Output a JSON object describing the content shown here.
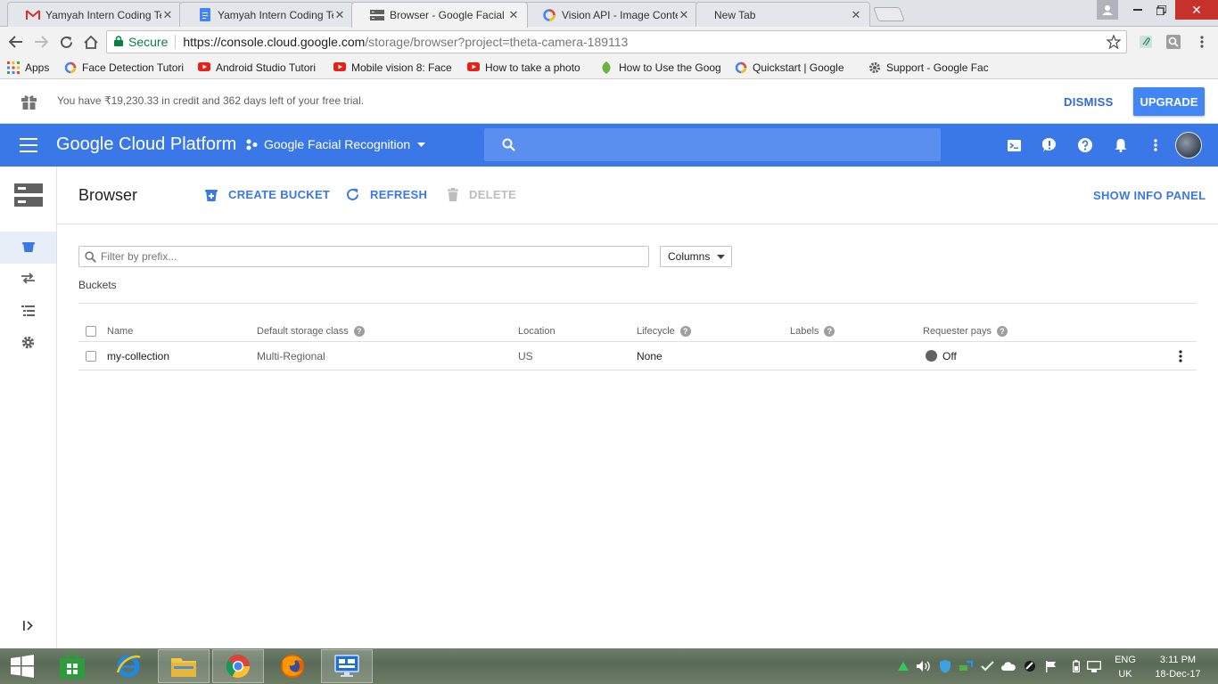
{
  "browser": {
    "tabs": [
      {
        "title": "Yamyah Intern Coding Te",
        "icon": "gmail-icon",
        "active": false
      },
      {
        "title": "Yamyah Intern Coding Te",
        "icon": "docs-icon",
        "active": false
      },
      {
        "title": "Browser - Google Facial",
        "icon": "storage-icon",
        "active": true
      },
      {
        "title": "Vision API - Image Conte",
        "icon": "google-icon",
        "active": false
      },
      {
        "title": "New Tab",
        "icon": "",
        "active": false
      }
    ],
    "secure_label": "Secure",
    "url_host": "https://console.cloud.google.com",
    "url_path": "/storage/browser?project=theta-camera-189113",
    "bookmarks": [
      {
        "label": "Apps",
        "icon": "apps-grid-icon"
      },
      {
        "label": "Face Detection Tutori",
        "icon": "google-icon"
      },
      {
        "label": "Android Studio Tutori",
        "icon": "youtube-icon"
      },
      {
        "label": "Mobile vision 8: Face",
        "icon": "youtube-icon"
      },
      {
        "label": "How to take a photo",
        "icon": "youtube-icon"
      },
      {
        "label": "How to Use the Goog",
        "icon": "leaf-icon"
      },
      {
        "label": "Quickstart  |  Google",
        "icon": "google-icon"
      },
      {
        "label": "Support - Google Fac",
        "icon": "gear-icon"
      }
    ]
  },
  "trial_banner": {
    "message": "You have ₹19,230.33 in credit and 362 days left of your free trial.",
    "dismiss": "DISMISS",
    "upgrade": "UPGRADE"
  },
  "header": {
    "title": "Google Cloud Platform",
    "project": "Google Facial Recognition"
  },
  "storage": {
    "page_title": "Browser",
    "actions": {
      "create": "CREATE BUCKET",
      "refresh": "REFRESH",
      "delete": "DELETE"
    },
    "show_info": "SHOW INFO PANEL",
    "filter_placeholder": "Filter by prefix...",
    "columns_label": "Columns",
    "section": "Buckets",
    "table": {
      "headers": [
        "Name",
        "Default storage class",
        "Location",
        "Lifecycle",
        "Labels",
        "Requester pays"
      ],
      "rows": [
        {
          "name": "my-collection",
          "storage_class": "Multi-Regional",
          "location": "US",
          "lifecycle": "None",
          "labels": "",
          "requester_pays": "Off"
        }
      ]
    }
  },
  "taskbar": {
    "lang_line1": "ENG",
    "lang_line2": "UK",
    "time": "3:11 PM",
    "date": "18-Dec-17"
  },
  "colors": {
    "gcp_blue": "#3b78e7",
    "link_blue": "#3367d6",
    "upgrade_blue": "#4285f4"
  }
}
